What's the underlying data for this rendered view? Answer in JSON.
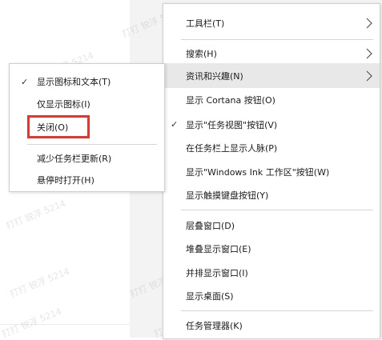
{
  "main_menu": {
    "items": [
      {
        "label": "工具栏(T)",
        "has_arrow": true
      },
      {
        "label": "搜索(H)",
        "has_arrow": true
      },
      {
        "label": "资讯和兴趣(N)",
        "has_arrow": true
      },
      {
        "label": "显示 Cortana 按钮(O)"
      },
      {
        "label": "显示\"任务视图\"按钮(V)",
        "checked": true
      },
      {
        "label": "在任务栏上显示人脉(P)"
      },
      {
        "label": "显示\"Windows Ink 工作区\"按钮(W)"
      },
      {
        "label": "显示触摸键盘按钮(Y)"
      },
      {
        "label": "层叠窗口(D)"
      },
      {
        "label": "堆叠显示窗口(E)"
      },
      {
        "label": "并排显示窗口(I)"
      },
      {
        "label": "显示桌面(S)"
      },
      {
        "label": "任务管理器(K)"
      }
    ]
  },
  "sub_menu": {
    "items": [
      {
        "label": "显示图标和文本(T)",
        "checked": true
      },
      {
        "label": "仅显示图标(I)"
      },
      {
        "label": "关闭(O)"
      },
      {
        "label": "减少任务栏更新(R)"
      },
      {
        "label": "悬停时打开(H)"
      }
    ]
  },
  "check_glyph": "✓",
  "watermark_text": "打打 锐浮 5214",
  "colors": {
    "highlight_border": "#e8342e",
    "hover_bg": "#e8e8e8"
  }
}
